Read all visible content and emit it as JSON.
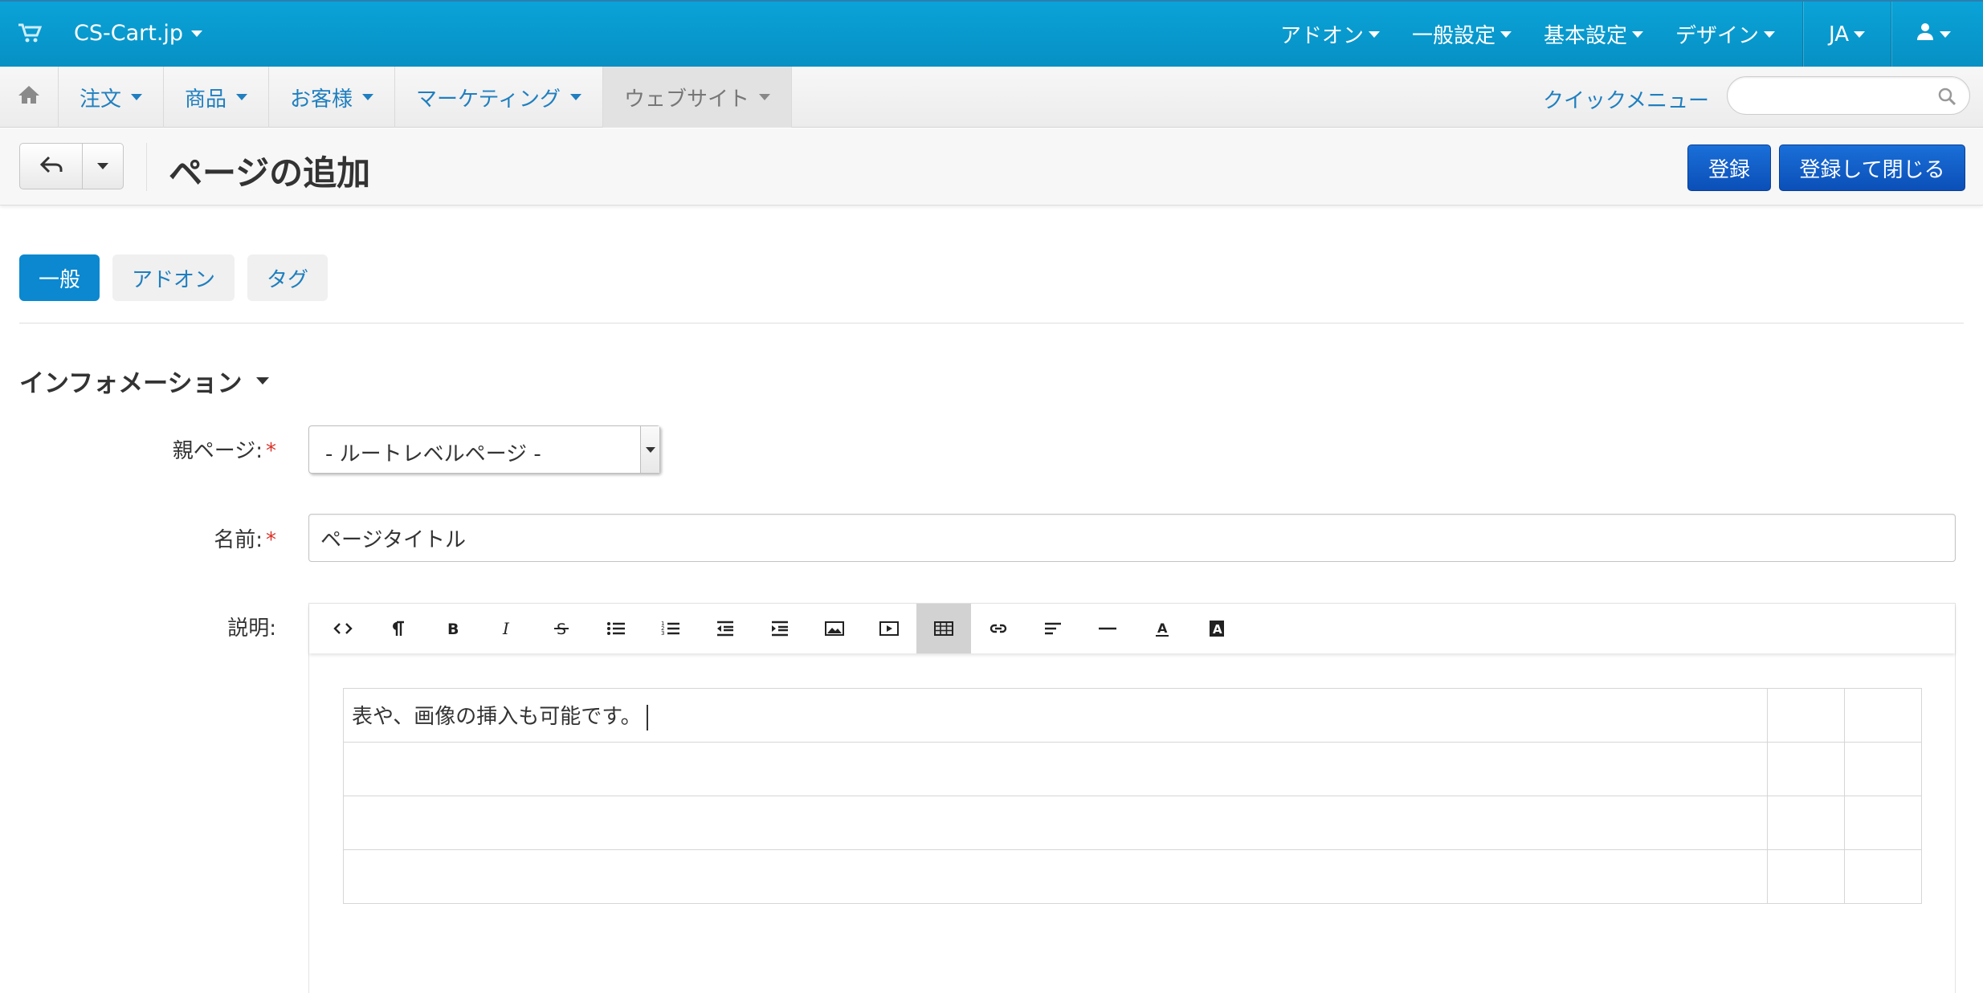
{
  "topbar": {
    "brand": "CS-Cart.jp",
    "menu": [
      "アドオン",
      "一般設定",
      "基本設定",
      "デザイン"
    ],
    "language": "JA"
  },
  "subnav": {
    "items": [
      "注文",
      "商品",
      "お客様",
      "マーケティング",
      "ウェブサイト"
    ],
    "active_index": 4,
    "quick_menu": "クイックメニュー",
    "search_placeholder": ""
  },
  "titlebar": {
    "title": "ページの追加",
    "save_label": "登録",
    "save_close_label": "登録して閉じる"
  },
  "tabs": [
    "一般",
    "アドオン",
    "タグ"
  ],
  "section": {
    "title": "インフォメーション"
  },
  "form": {
    "parent_label": "親ページ:",
    "parent_value": "- ルートレベルページ -",
    "name_label": "名前:",
    "name_value": "ページタイトル",
    "description_label": "説明:",
    "required_mark": "*"
  },
  "editor": {
    "toolbar_icons": [
      "code-icon",
      "paragraph-icon",
      "bold-icon",
      "italic-icon",
      "strikethrough-icon",
      "bulleted-list-icon",
      "numbered-list-icon",
      "outdent-icon",
      "indent-icon",
      "image-icon",
      "video-icon",
      "table-icon",
      "link-icon",
      "align-icon",
      "horizontal-rule-icon",
      "font-color-icon",
      "background-color-icon"
    ],
    "active_tool": "table-icon",
    "table": [
      [
        "表や、画像の挿入も可能です。",
        "",
        ""
      ],
      [
        "",
        "",
        ""
      ],
      [
        "",
        "",
        ""
      ],
      [
        "",
        "",
        ""
      ]
    ]
  },
  "colors": {
    "topbar": "#0aa3d8",
    "link": "#1f7fbf",
    "primary_button": "#0b4fb8",
    "active_tab": "#0b88cf",
    "required": "#d9342b"
  }
}
